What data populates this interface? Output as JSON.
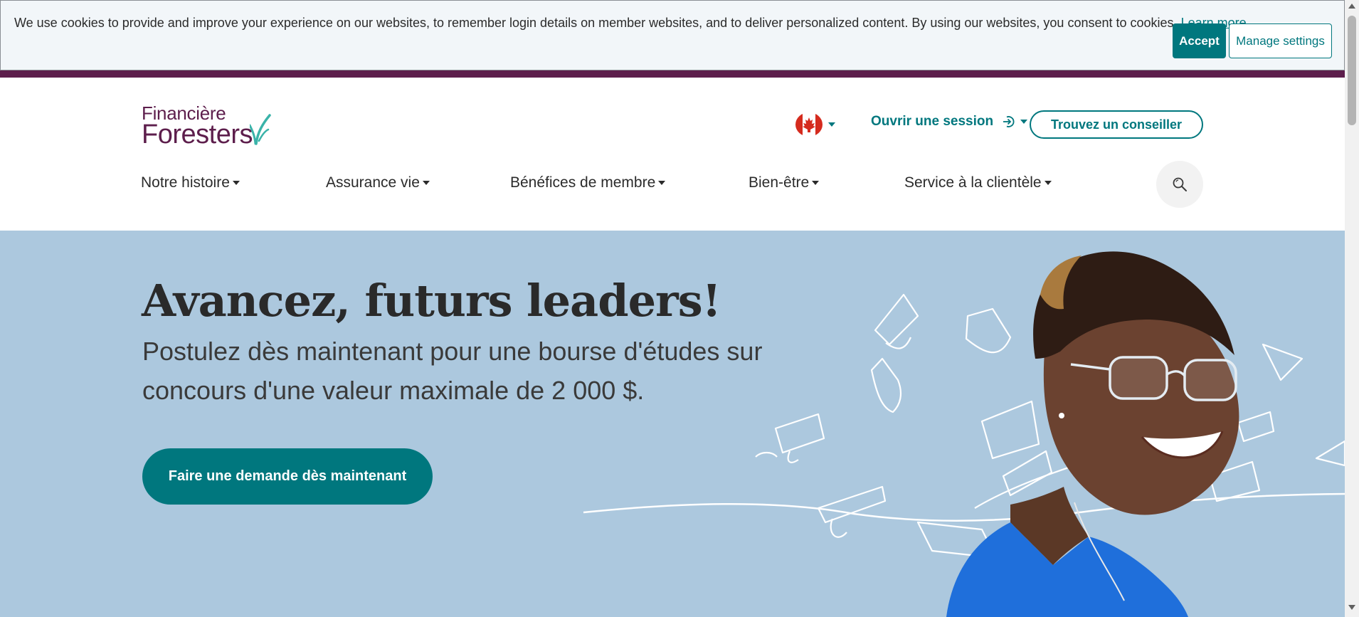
{
  "cookie_banner": {
    "message": "We use cookies to provide and improve your experience on our websites, to remember login details on member websites, and to deliver personalized content. By using our websites, you consent to cookies.",
    "learn_more": "Learn more",
    "period": ".",
    "accept_label": "Accept",
    "manage_label": "Manage settings"
  },
  "logo": {
    "line1": "Financière",
    "line2": "Foresters"
  },
  "header": {
    "language_flag_icon": "canada-flag-icon",
    "login_label": "Ouvrir une session",
    "login_icon": "sign-in-icon",
    "advisor_label": "Trouvez un conseiller"
  },
  "nav": {
    "items": [
      {
        "label": "Notre histoire"
      },
      {
        "label": "Assurance vie"
      },
      {
        "label": "Bénéfices de membre"
      },
      {
        "label": "Bien-être"
      },
      {
        "label": "Service à la clientèle"
      }
    ],
    "search_icon": "search-icon"
  },
  "hero": {
    "title": "Avancez, futurs leaders!",
    "subtitle": "Postulez dès maintenant pour une bourse d'études sur concours d'une valeur maximale de 2 000 $.",
    "cta_label": "Faire une demande dès maintenant",
    "image_icon": "smiling-student-with-graduation-caps-illustration"
  },
  "colors": {
    "brand_teal": "#00777e",
    "brand_purple": "#5d1e4c",
    "hero_background": "#acc8de",
    "cookie_background": "#f2f6f9"
  }
}
